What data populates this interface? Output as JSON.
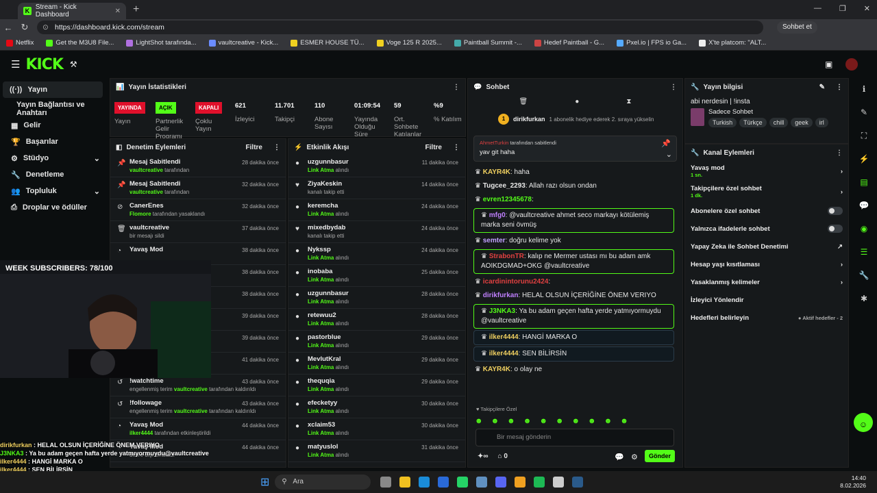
{
  "browser": {
    "tab_title": "Stream - Kick Dashboard",
    "url": "https://dashboard.kick.com/stream",
    "chat_button": "Sohbet et"
  },
  "bookmarks": [
    "Netflix",
    "Get the M3U8 File...",
    "LightShot tarafında...",
    "vaultcreative - Kick...",
    "ESMER HOUSE TÜ...",
    "Voge 125 R 2025...",
    "Paintball Summit -...",
    "Hedef Paintball - G...",
    "Pxel.io | FPS io Ga...",
    "X'te platcom: \"ALT..."
  ],
  "sidebar": {
    "items": [
      "Yayın",
      "Yayın Bağlantısı ve Anahtarı",
      "Gelir",
      "Başarılar",
      "Stüdyo",
      "Denetleme",
      "Topluluk",
      "Droplar ve ödüller"
    ]
  },
  "stats": {
    "title": "Yayın İstatistikleri",
    "stream_badge": "YAYINDA",
    "stream_label": "Yayın",
    "partner_badge": "AÇIK",
    "partner_label": "Partnerlik Gelir Programı",
    "multi_badge": "KAPALI",
    "multi_label": "Çoklu Yayın",
    "viewers": "621",
    "viewers_label": "İzleyici",
    "followers": "11.701",
    "followers_label": "Takipçi",
    "subs": "110",
    "subs_label": "Abone Sayısı",
    "duration": "01:09:54",
    "duration_label": "Yayında Olduğu Süre",
    "avg": "59",
    "avg_label": "Ort. Sohbete Katılanlar",
    "rate": "%9",
    "rate_label": "% Katılım"
  },
  "moderation": {
    "title": "Denetim Eylemleri",
    "filter": "Filtre",
    "rows": [
      {
        "t": "Mesaj Sabitlendi",
        "s": "vaultcreative",
        "s2": " tarafından",
        "time": "28 dakika önce",
        "ic": "📌"
      },
      {
        "t": "Mesaj Sabitlendi",
        "s": "vaultcreative",
        "s2": " tarafından",
        "time": "32 dakika önce",
        "ic": "📌"
      },
      {
        "t": "CanerEnes",
        "s": "Flomore",
        "s2": " tarafından yasaklandı",
        "time": "32 dakika önce",
        "ic": "⊘"
      },
      {
        "t": "vaultcreative",
        "s": "",
        "s2": "bir mesajı sildi",
        "time": "37 dakika önce",
        "ic": "🗑"
      },
      {
        "t": "Yavaş Mod",
        "s": "",
        "s2": "",
        "time": "38 dakika önce",
        "ic": "◔"
      },
      {
        "t": "",
        "s": "",
        "s2": "",
        "time": "38 dakika önce",
        "ic": ""
      },
      {
        "t": "",
        "s": "",
        "s2": "",
        "time": "38 dakika önce",
        "ic": ""
      },
      {
        "t": "",
        "s": "",
        "s2": "",
        "time": "39 dakika önce",
        "ic": ""
      },
      {
        "t": "",
        "s": "",
        "s2": "",
        "time": "39 dakika önce",
        "ic": ""
      },
      {
        "t": "",
        "s": "",
        "s2": "",
        "time": "41 dakika önce",
        "ic": ""
      },
      {
        "t": "!watchtime",
        "s": "vaultcreative",
        "s2": " tarafından kaldırıldı",
        "pre": "engellenmiş terim ",
        "time": "43 dakika önce",
        "ic": "↺"
      },
      {
        "t": "!followage",
        "s": "vaultcreative",
        "s2": " tarafından kaldırıldı",
        "pre": "engellenmiş terim ",
        "time": "43 dakika önce",
        "ic": "↺"
      },
      {
        "t": "Yavaş Mod",
        "s": "ilker4444",
        "s2": " tarafından etkinleştirildi",
        "time": "44 dakika önce",
        "ic": "◔"
      },
      {
        "t": "Yavaş Mod",
        "s": "",
        "s2": "devre dışı bırakıldı",
        "time": "44 dakika önce",
        "ic": "◔"
      }
    ]
  },
  "activity": {
    "title": "Etkinlik Akışı",
    "filter": "Filtre",
    "rows": [
      {
        "t": "uzgunnbasur",
        "s": "Link Atma",
        "s2": " alındı",
        "time": "11 dakika önce",
        "ic": "●"
      },
      {
        "t": "ZiyaKeskin",
        "s": "",
        "s2": "kanalı takip etti",
        "time": "14 dakika önce",
        "ic": "♥"
      },
      {
        "t": "keremcha",
        "s": "Link Atma",
        "s2": " alındı",
        "time": "24 dakika önce",
        "ic": "●"
      },
      {
        "t": "mixedbydab",
        "s": "",
        "s2": "kanalı takip etti",
        "time": "24 dakika önce",
        "ic": "♥"
      },
      {
        "t": "Nykssp",
        "s": "Link Atma",
        "s2": " alındı",
        "time": "24 dakika önce",
        "ic": "●"
      },
      {
        "t": "inobaba",
        "s": "Link Atma",
        "s2": " alındı",
        "time": "25 dakika önce",
        "ic": "●"
      },
      {
        "t": "uzgunnbasur",
        "s": "Link Atma",
        "s2": " alındı",
        "time": "28 dakika önce",
        "ic": "●"
      },
      {
        "t": "retewuu2",
        "s": "Link Atma",
        "s2": " alındı",
        "time": "28 dakika önce",
        "ic": "●"
      },
      {
        "t": "pastorblue",
        "s": "Link Atma",
        "s2": " alındı",
        "time": "29 dakika önce",
        "ic": "●"
      },
      {
        "t": "MevlutKral",
        "s": "Link Atma",
        "s2": " alındı",
        "time": "29 dakika önce",
        "ic": "●"
      },
      {
        "t": "thequqia",
        "s": "Link Atma",
        "s2": " alındı",
        "time": "29 dakika önce",
        "ic": "●"
      },
      {
        "t": "efecketyy",
        "s": "Link Atma",
        "s2": " alındı",
        "time": "30 dakika önce",
        "ic": "●"
      },
      {
        "t": "xclaim53",
        "s": "Link Atma",
        "s2": " alındı",
        "time": "30 dakika önce",
        "ic": "●"
      },
      {
        "t": "matyuslol",
        "s": "Link Atma",
        "s2": " alındı",
        "time": "31 dakika önce",
        "ic": "●"
      }
    ]
  },
  "chat": {
    "title": "Sohbet",
    "gift_user": "dirikfurkan",
    "gift_text": "1 abonelik hediye ederek 2. sıraya yükselin",
    "gift_rank": "1",
    "pinned_by": "AhmetTurkin",
    "pinned_suffix": " tarafından sabitlendi",
    "pinned_msg": "yav git haha",
    "messages": [
      {
        "u": "KAYR4K",
        "c": "#f0d060",
        "m": "haha",
        "style": ""
      },
      {
        "u": "Tugcee_2293",
        "c": "#e8e8e8",
        "m": "Allah razı olsun ondan",
        "style": ""
      },
      {
        "u": "evren12345678",
        "c": "#53fc18",
        "m": "",
        "style": ""
      },
      {
        "u": "mfg0",
        "c": "#c080ff",
        "m": "@vaultcreative ahmet seco markayı kötülemiş marka seni övmüş",
        "style": "box"
      },
      {
        "u": "semter",
        "c": "#c0a0ff",
        "m": "doğru kelime yok",
        "style": ""
      },
      {
        "u": "StrabonTR",
        "c": "#e04040",
        "m": "kalıp ne Mermer ustası mı bu adam amk AOIKDGMAD+OKG @vaultcreative",
        "style": "box"
      },
      {
        "u": "icardinintorunu2424",
        "c": "#e04040",
        "m": "",
        "style": ""
      },
      {
        "u": "dirikfurkan",
        "c": "#c080ff",
        "m": "HELAL OLSUN İÇERİĞİNE ÖNEM VERIYO",
        "style": ""
      },
      {
        "u": "J3NKA3",
        "c": "#53fc18",
        "m": "Ya bu adam geçen hafta yerde yatmıyormuydu @vaultcreative",
        "style": "box"
      },
      {
        "u": "ilker4444",
        "c": "#f0d060",
        "m": "HANGİ MARKA O",
        "style": "blue"
      },
      {
        "u": "ilker4444",
        "c": "#f0d060",
        "m": "SEN BİLİRSİN",
        "style": "blue"
      },
      {
        "u": "KAYR4K",
        "c": "#f0d060",
        "m": "o olay ne",
        "style": ""
      }
    ],
    "followers_only": "Takipçilere Özel",
    "input_placeholder": "Bir mesaj gönderin",
    "points": "0",
    "send": "Gönder"
  },
  "stream_info": {
    "title": "Yayın bilgisi",
    "stream_title": "abi nerdesin | !insta",
    "category": "Sadece Sohbet",
    "tags": [
      "Turkish",
      "Türkçe",
      "chill",
      "geek",
      "irl"
    ]
  },
  "channel_actions": {
    "title": "Kanal Eylemleri",
    "items": [
      {
        "label": "Yavaş mod",
        "sub": "1 sn.",
        "ctrl": "chev"
      },
      {
        "label": "Takipçilere özel sohbet",
        "sub": "1 dk.",
        "ctrl": "chev"
      },
      {
        "label": "Abonelere özel sohbet",
        "sub": "",
        "ctrl": "toggle"
      },
      {
        "label": "Yalnızca ifadelerle sohbet",
        "sub": "",
        "ctrl": "toggle"
      },
      {
        "label": "Yapay Zeka ile Sohbet Denetimi",
        "sub": "",
        "ctrl": "ext"
      },
      {
        "label": "Hesap yaşı kısıtlaması",
        "sub": "",
        "ctrl": "chev"
      },
      {
        "label": "Yasaklanmış kelimeler",
        "sub": "",
        "ctrl": "chev"
      },
      {
        "label": "İzleyici Yönlendir",
        "sub": "",
        "ctrl": ""
      },
      {
        "label": "Hedefleri belirleyin",
        "sub": "",
        "ctrl": "goal"
      }
    ],
    "goal_text": "Aktif hedefler - 2"
  },
  "webcam": {
    "overlay": "WEEK SUBSCRIBERS: 78/100"
  },
  "overlay_chat": [
    {
      "u": "dirikfurkan",
      "m": " : HELAL OLSUN İÇERİĞİNE ÖNEM VERIYO"
    },
    {
      "u": "J3NKA3",
      "m": " : Ya bu adam geçen hafta yerde yatmıyormuydu@vaultcreative"
    },
    {
      "u": "ilker4444",
      "m": " : HANGİ MARKA O"
    },
    {
      "u": "ilker4444",
      "m": " : SEN BİLİRSİN"
    },
    {
      "u": "KAYR4K",
      "m": " : o olay ne"
    }
  ],
  "taskbar": {
    "search": "Ara",
    "time": "14:40",
    "date": "8.02.2026"
  }
}
